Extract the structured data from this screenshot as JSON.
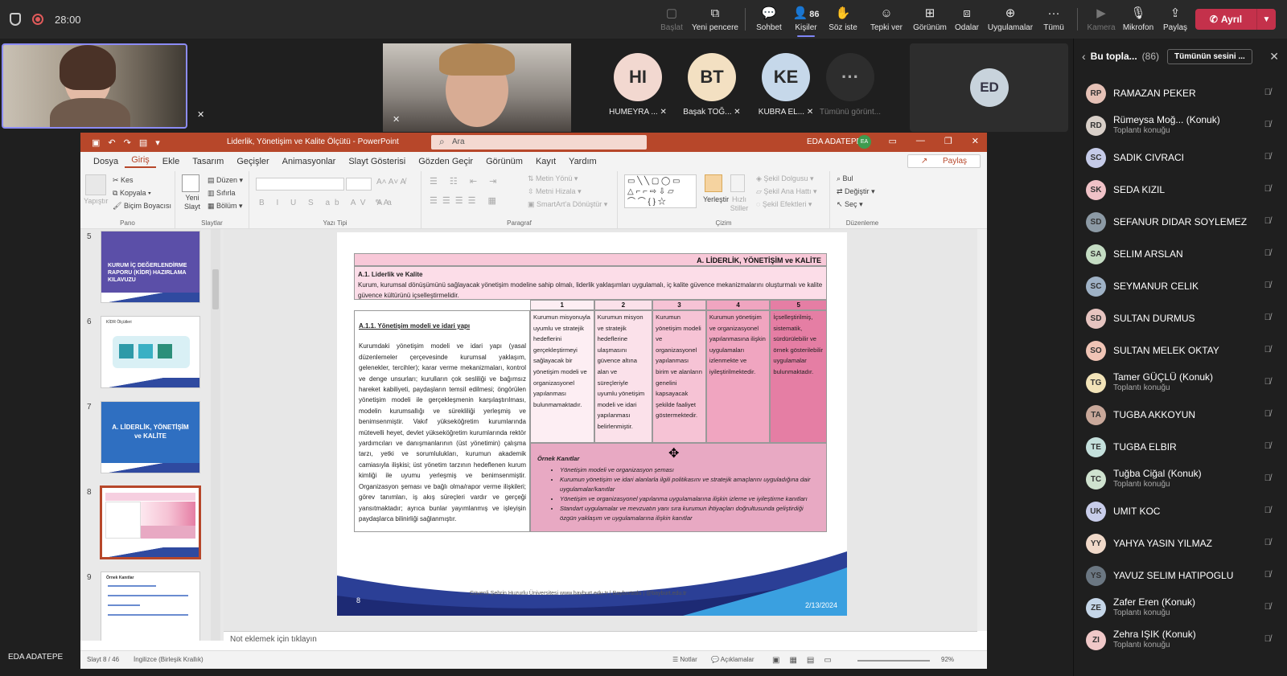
{
  "topbar": {
    "timer": "28:00",
    "actions": [
      {
        "label": "Başlat",
        "icon": "start-icon",
        "dim": true
      },
      {
        "label": "Yeni pencere",
        "icon": "new-window-icon"
      },
      {
        "label": "Sohbet",
        "icon": "chat-icon"
      },
      {
        "label": "Kişiler",
        "icon": "people-icon",
        "badge": "86"
      },
      {
        "label": "Söz iste",
        "icon": "raise-hand-icon"
      },
      {
        "label": "Tepki ver",
        "icon": "react-icon"
      },
      {
        "label": "Görünüm",
        "icon": "view-icon"
      },
      {
        "label": "Odalar",
        "icon": "rooms-icon"
      },
      {
        "label": "Uygulamalar",
        "icon": "apps-icon"
      },
      {
        "label": "Tümü",
        "icon": "more-icon"
      },
      {
        "label": "Kamera",
        "icon": "camera-icon",
        "dim": true
      },
      {
        "label": "Mikrofon",
        "icon": "mic-icon"
      },
      {
        "label": "Paylaş",
        "icon": "share-icon"
      }
    ],
    "leave_label": "Ayrıl"
  },
  "stage": {
    "avatars": [
      {
        "initials": "HI",
        "name": "HUMEYRA ...",
        "color": "#f2d8d0"
      },
      {
        "initials": "BT",
        "name": "Başak TOĞ...",
        "color": "#f3e0c2"
      },
      {
        "initials": "KE",
        "name": "KUBRA EL...",
        "color": "#c6d8ea"
      }
    ],
    "more_label": "Tümünü görünt...",
    "ed_initials": "ED",
    "self_name": "EDA ADATEPE"
  },
  "panel": {
    "title": "Bu topla...",
    "count": "(86)",
    "mute_all": "Tümünün sesini ...",
    "participants": [
      {
        "initials": "RP",
        "name": "RAMAZAN PEKER",
        "sub": "",
        "color": "#e5c1b6"
      },
      {
        "initials": "RD",
        "name": "Rümeysa Moğ... (Konuk)",
        "sub": "Toplantı konuğu",
        "color": "#d8cfc8"
      },
      {
        "initials": "SC",
        "name": "SADIK CIVRACI",
        "sub": "",
        "color": "#c5cbe8"
      },
      {
        "initials": "SK",
        "name": "SEDA KIZIL",
        "sub": "",
        "color": "#f0c2c7"
      },
      {
        "initials": "SD",
        "name": "SEFANUR DIDAR SOYLEMEZ",
        "sub": "",
        "color": "#8c9aa5"
      },
      {
        "initials": "SA",
        "name": "SELIM ARSLAN",
        "sub": "",
        "color": "#c4dcc3"
      },
      {
        "initials": "SC",
        "name": "SEYMANUR CELIK",
        "sub": "",
        "color": "#9fb2c6"
      },
      {
        "initials": "SD",
        "name": "SULTAN DURMUS",
        "sub": "",
        "color": "#e6c4c0"
      },
      {
        "initials": "SO",
        "name": "SULTAN MELEK OKTAY",
        "sub": "",
        "color": "#f0c4b5"
      },
      {
        "initials": "TG",
        "name": "Tamer GÜÇLÜ (Konuk)",
        "sub": "Toplantı konuğu",
        "color": "#f2e3b8"
      },
      {
        "initials": "TA",
        "name": "TUGBA AKKOYUN",
        "sub": "",
        "color": "#c9a89a"
      },
      {
        "initials": "TE",
        "name": "TUGBA ELBIR",
        "sub": "",
        "color": "#c4e0dc"
      },
      {
        "initials": "TC",
        "name": "Tuğba Ciğal (Konuk)",
        "sub": "Toplantı konuğu",
        "color": "#cfe2cf"
      },
      {
        "initials": "UK",
        "name": "UMIT KOC",
        "sub": "",
        "color": "#c8cdea"
      },
      {
        "initials": "YY",
        "name": "YAHYA YASIN YILMAZ",
        "sub": "",
        "color": "#f0d9c9"
      },
      {
        "initials": "YS",
        "name": "YAVUZ SELIM HATIPOGLU",
        "sub": "",
        "color": "#6b7782"
      },
      {
        "initials": "ZE",
        "name": "Zafer Eren (Konuk)",
        "sub": "Toplantı konuğu",
        "color": "#c5d6e8"
      },
      {
        "initials": "ZI",
        "name": "Zehra IŞIK (Konuk)",
        "sub": "Toplantı konuğu",
        "color": "#f0c8c8"
      }
    ]
  },
  "ppt": {
    "doc_title": "Liderlik, Yönetişim ve Kalite Ölçütü  -  PowerPoint",
    "search_placeholder": "Ara",
    "user": "EDA ADATEPE",
    "user_initials": "EA",
    "menu": [
      "Dosya",
      "Giriş",
      "Ekle",
      "Tasarım",
      "Geçişler",
      "Animasyonlar",
      "Slayt Gösterisi",
      "Gözden Geçir",
      "Görünüm",
      "Kayıt",
      "Yardım"
    ],
    "share": "Paylaş",
    "ribbon": {
      "pano": "Pano",
      "yapistir": "Yapıştır",
      "kes": "Kes",
      "kopyala": "Kopyala",
      "bicim": "Biçim Boyacısı",
      "slaytlar": "Slaytlar",
      "yeni_slayt": "Yeni Slayt",
      "duzen": "Düzen",
      "sifirla": "Sıfırla",
      "bolum": "Bölüm",
      "yazi_tipi": "Yazı Tipi",
      "paragraf": "Paragraf",
      "metin_yonu": "Metin Yönü",
      "metni_hizala": "Metni Hizala",
      "smartart": "SmartArt'a Dönüştür",
      "cizim": "Çizim",
      "yerlestir": "Yerleştir",
      "hizli_stiller": "Hızlı Stiller",
      "sekil_dolgusu": "Şekil Dolgusu",
      "sekil_ana_hatti": "Şekil Ana Hattı",
      "sekil_efektleri": "Şekil Efektleri",
      "duzenleme": "Düzenleme",
      "bul": "Bul",
      "degistir": "Değiştir",
      "sec": "Seç"
    },
    "thumbs": [
      {
        "num": "5",
        "title": "KURUM İÇ DEĞERLENDİRME RAPORU (KİDR) HAZIRLAMA KILAVUZU"
      },
      {
        "num": "6",
        "title": "KİDR Ölçütleri"
      },
      {
        "num": "7",
        "title": "A. LİDERLİK, YÖNETİŞİM ve KALİTE"
      },
      {
        "num": "8",
        "title": ""
      },
      {
        "num": "9",
        "title": "Örnek Kanıtlar"
      }
    ],
    "notes_placeholder": "Not eklemek için tıklayın",
    "status": {
      "slide": "Slayt 8 / 46",
      "lang": "İngilizce (Birleşik Krallık)",
      "notes": "Notlar",
      "comments": "Açıklamalar",
      "zoom": "92%"
    },
    "slide": {
      "header": "A. LİDERLİK, YÖNETİŞİM ve KALİTE",
      "a1_title": "A.1. Liderlik ve Kalite",
      "a1_text": "Kurum, kurumsal dönüşümünü sağlayacak yönetişim modeline sahip olmalı, liderlik yaklaşımları uygulamalı, iç kalite güvence mekanizmalarını oluşturmalı ve kalite güvence kültürünü içselleştirmelidir.",
      "cols": [
        "1",
        "2",
        "3",
        "4",
        "5"
      ],
      "sub_title": "A.1.1. Yönetişim modeli ve idari yapı",
      "body": "Kurumdaki yönetişim modeli ve idari yapı (yasal düzenlemeler çerçevesinde kurumsal yaklaşım, gelenekler, tercihler); karar verme mekanizmaları, kontrol ve denge unsurları; kurulların çok sesliliği ve bağımsız hareket kabiliyeti, paydaşların temsil edilmesi; öngörülen yönetişim modeli ile gerçekleşmenin karşılaştırılması, modelin kurumsallığı ve sürekliliği yerleşmiş ve benimsenmiştir. Vakıf yükseköğretim kurumlarında mütevelli heyet, devlet yükseköğretim kurumlarında rektör yardımcıları ve danışmanlarının (üst yönetimin) çalışma tarzı, yetki ve sorumlulukları, kurumun akademik camiasıyla ilişkisi; üst yönetim tarzının hedeflenen kurum kimliği ile uyumu yerleşmiş ve benimsenmiştir. Organizasyon şeması ve bağlı olma/rapor verme ilişkileri; görev tanımları, iş akış süreçleri vardır ve gerçeği yansıtmaktadır; ayrıca bunlar yayımlanmış ve işleyişin paydaşlarca bilinirliği sağlanmıştır.",
      "levels": [
        "Kurumun misyonuyla uyumlu ve stratejik hedeflerini gerçekleştirmeyi sağlayacak bir yönetişim modeli ve organizasyonel yapılanması bulunmamaktadır.",
        "Kurumun misyon ve stratejik hedeflerine ulaşmasını güvence altına alan ve süreçleriyle uyumlu yönetişim modeli ve idari yapılanması belirlenmiştir.",
        "Kurumun yönetişim modeli ve organizasyonel yapılanması birim ve alanların genelini kapsayacak şekilde faaliyet göstermektedir.",
        "Kurumun yönetişim ve organizasyonel yapılanmasına ilişkin uygulamaları izlenmekte ve iyileştirilmektedir.",
        "İçselleştirilmiş, sistematik, sürdürülebilir ve örnek gösterilebilir uygulamalar bulunmaktadır."
      ],
      "ornek_title": "Örnek Kanıtlar",
      "ornek": [
        "Yönetişim modeli ve organizasyon şeması",
        "Kurumun yönetişim ve idari alanlarla ilgili politikasını ve stratejik amaçlarını uyguladığına dair uygulamalar/kanıtlar",
        "Yönetişim ve organizasyonel yapılanma uygulamalarına ilişkin izleme ve iyileştirme kanıtları",
        "Standart uygulamalar ve mevzuatın yanı sıra kurumun ihtiyaçları doğrultusunda geliştirdiği özgün yaklaşım ve uygulamalarına ilişkin kanıtlar"
      ],
      "slide_num": "8",
      "date": "2/13/2024",
      "footer_text": "Güvenli Şehrin Huzurlu Üniversitesi   www.bayburt.edu.tr   |   Bayburtedu   |   @bayburt.edu.tr"
    }
  },
  "colors": {
    "teams_bar": "#292929",
    "ppt_red": "#b7472a",
    "leave_red": "#c4314b",
    "accent": "#7f85f5"
  }
}
